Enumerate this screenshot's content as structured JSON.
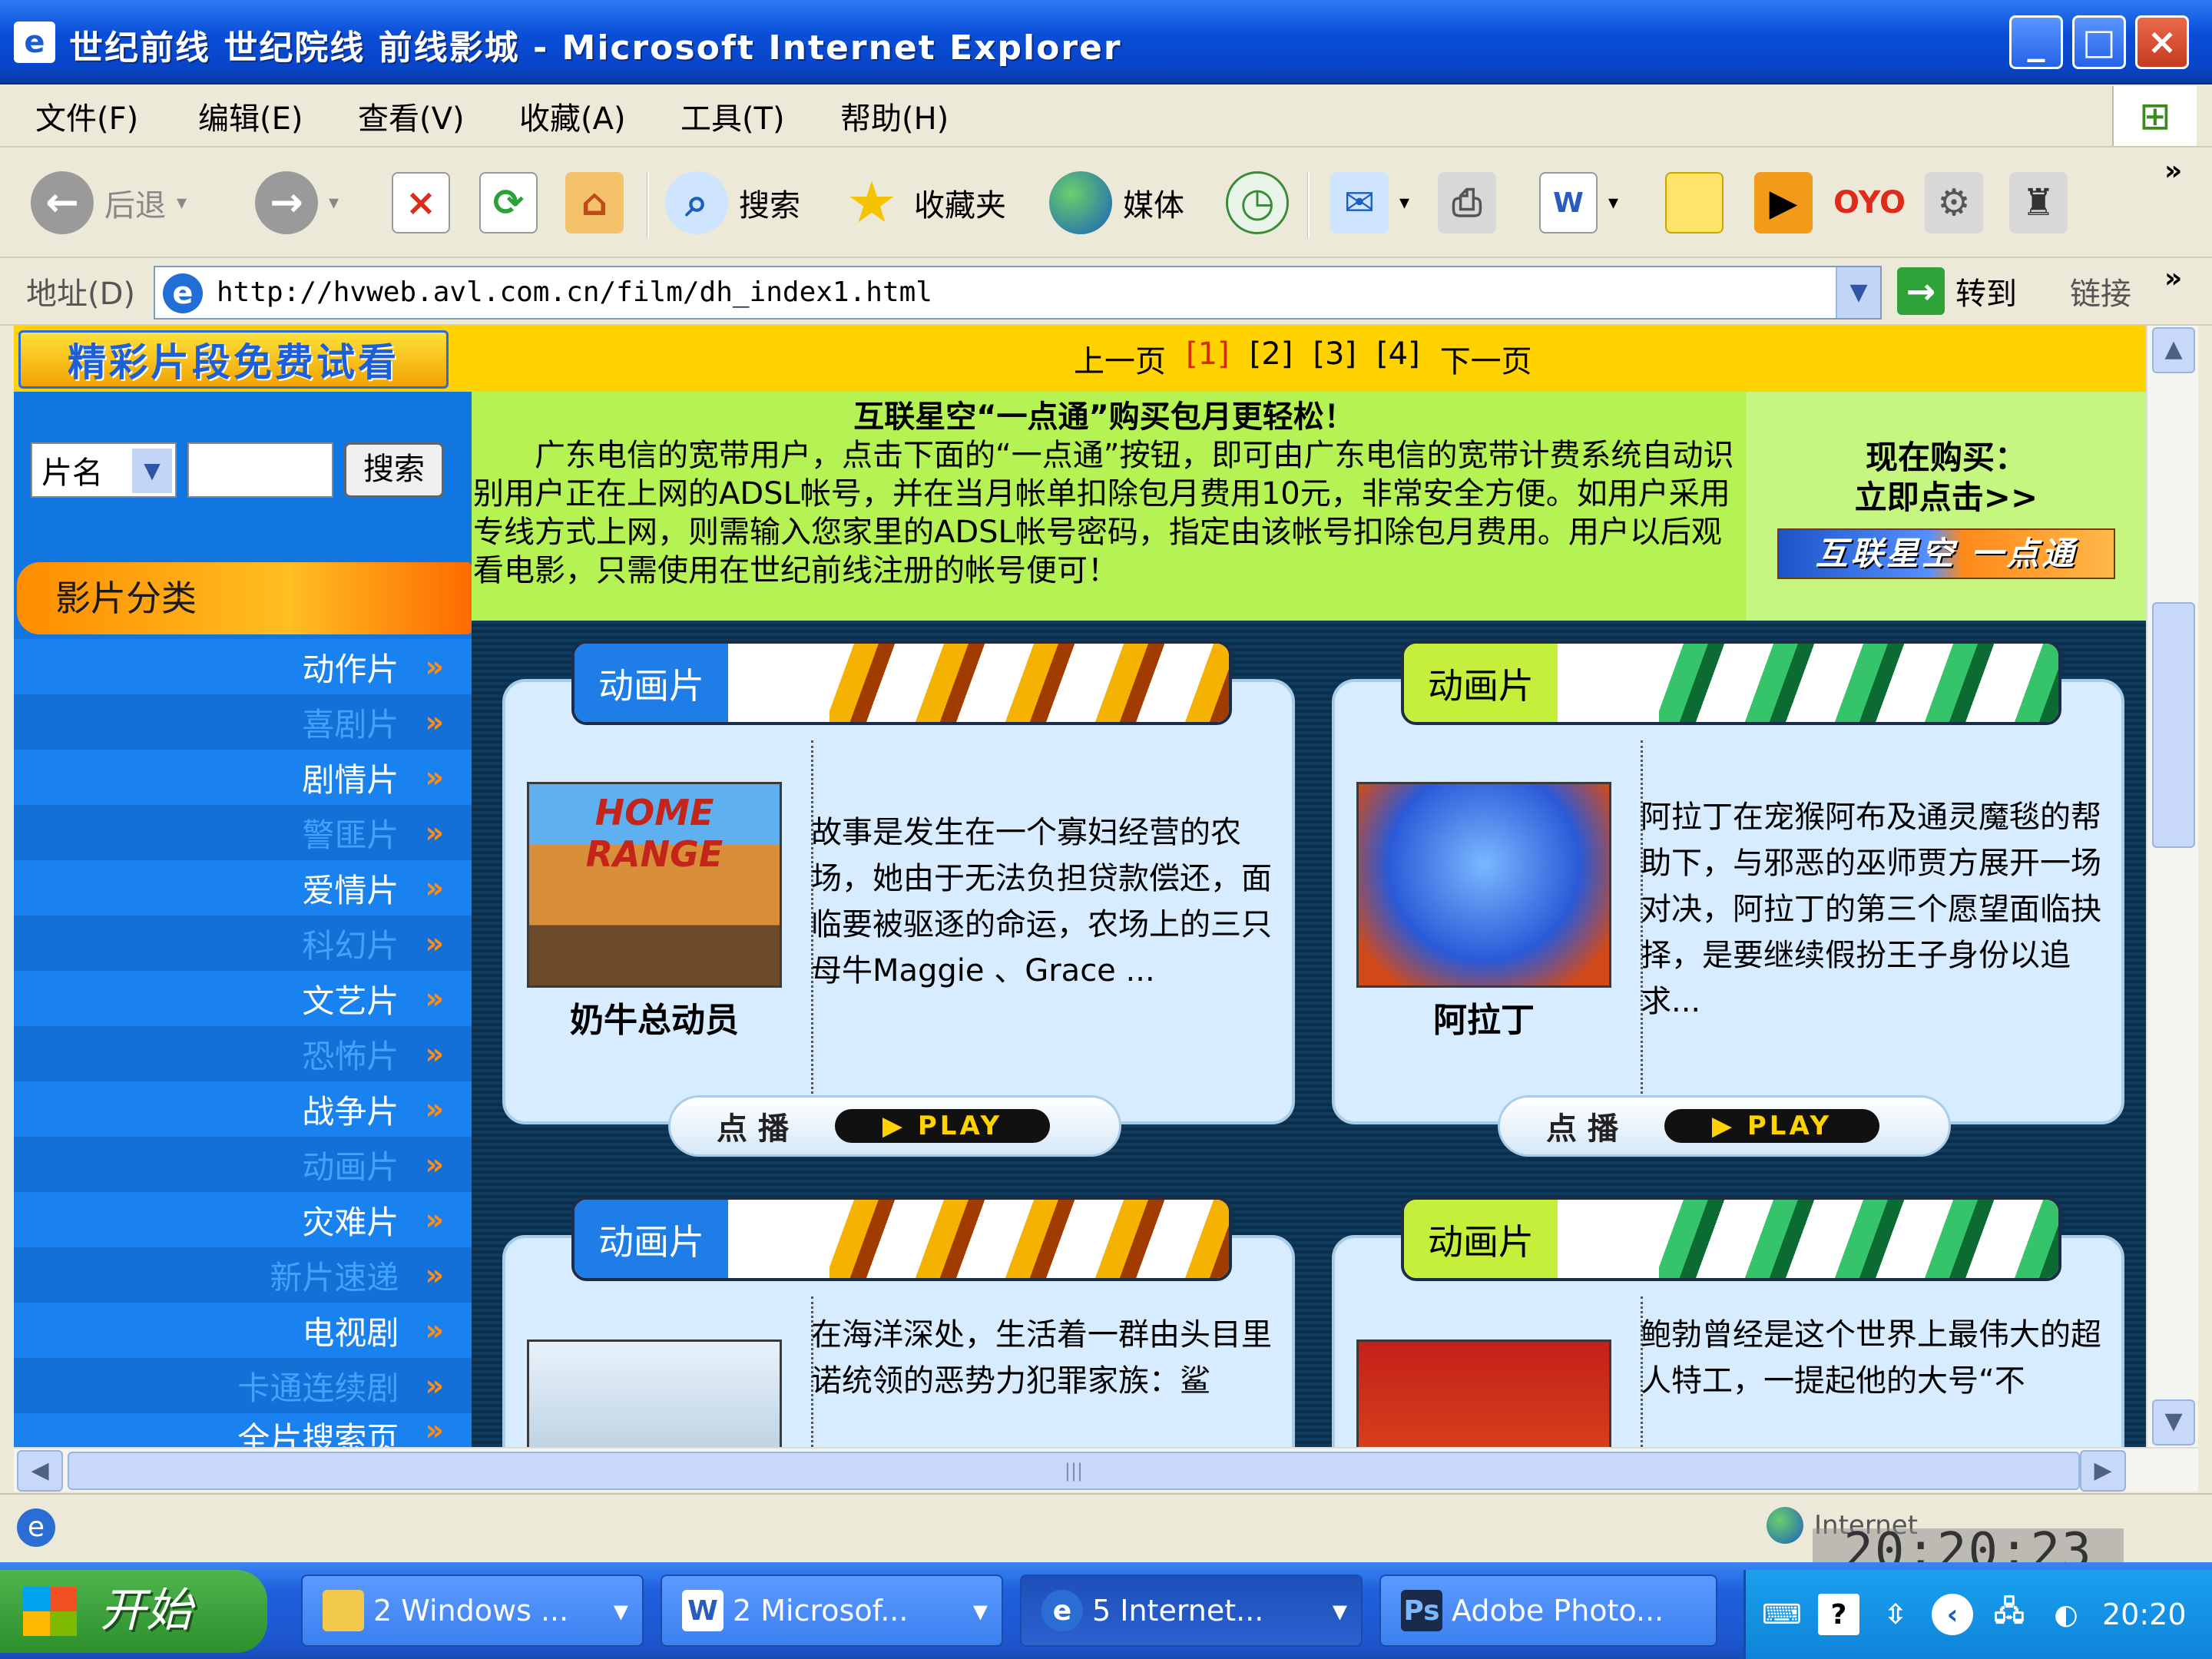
{
  "window": {
    "title": "世纪前线 世纪院线 前线影城 - Microsoft Internet Explorer",
    "min": "_",
    "max": "□",
    "close": "×"
  },
  "menu": [
    "文件(F)",
    "编辑(E)",
    "查看(V)",
    "收藏(A)",
    "工具(T)",
    "帮助(H)"
  ],
  "toolbar": {
    "back": "后退",
    "search": "搜索",
    "favorites": "收藏夹",
    "media": "媒体"
  },
  "address": {
    "label": "地址(D)",
    "url": "http://hvweb.avl.com.cn/film/dh_index1.html",
    "go": "转到",
    "links": "链接"
  },
  "page": {
    "brand": "精彩片段免费试看",
    "pager": {
      "prev": "上一页",
      "pages": [
        "[1]",
        "[2]",
        "[3]",
        "[4]"
      ],
      "next": "下一页"
    },
    "search": {
      "select": "片名",
      "button": "搜索"
    },
    "category_head": "影片分类",
    "categories": [
      "动作片",
      "喜剧片",
      "剧情片",
      "警匪片",
      "爱情片",
      "科幻片",
      "文艺片",
      "恐怖片",
      "战争片",
      "动画片",
      "灾难片",
      "新片速递",
      "电视剧",
      "卡通连续剧",
      "全片搜索页"
    ],
    "promo": {
      "title": "互联星空“一点通”购买包月更轻松！",
      "body": "广东电信的宽带用户，点击下面的“一点通”按钮，即可由广东电信的宽带计费系统自动识别用户正在上网的ADSL帐号，并在当月帐单扣除包月费用10元，非常安全方便。如用户采用专线方式上网，则需输入您家里的ADSL帐号密码，指定由该帐号扣除包月费用。用户以后观看电影，只需使用在世纪前线注册的帐号便可！",
      "buy_line1": "现在购买：",
      "buy_line2": "立即点击>>",
      "logo": "互联星空 一点通"
    },
    "cards": [
      {
        "tab": "动画片",
        "title": "奶牛总动员",
        "desc": "故事是发生在一个寡妇经营的农场，她由于无法负担贷款偿还，面临要被驱逐的命运，农场上的三只母牛Maggie 、Grace ...",
        "play_cn": "点播",
        "play_en": "▶ PLAY"
      },
      {
        "tab": "动画片",
        "title": "阿拉丁",
        "desc": "阿拉丁在宠猴阿布及通灵魔毯的帮助下，与邪恶的巫师贾方展开一场对决，阿拉丁的第三个愿望面临抉择，是要继续假扮王子身份以追求...",
        "play_cn": "点播",
        "play_en": "▶ PLAY"
      },
      {
        "tab": "动画片",
        "title": "",
        "desc": "在海洋深处，生活着一群由头目里诺统领的恶势力犯罪家族：鲨",
        "play_cn": "",
        "play_en": ""
      },
      {
        "tab": "动画片",
        "title": "",
        "desc": "鲍勃曾经是这个世界上最伟大的超人特工，一提起他的大号“不",
        "play_cn": "",
        "play_en": ""
      }
    ]
  },
  "status": {
    "zone": "Internet",
    "overlay_time": "20:20:23"
  },
  "taskbar": {
    "start": "开始",
    "tasks": [
      "2 Windows ...",
      "2 Microsof...",
      "5 Internet...",
      "Adobe Photo..."
    ],
    "clock": "20:20"
  }
}
